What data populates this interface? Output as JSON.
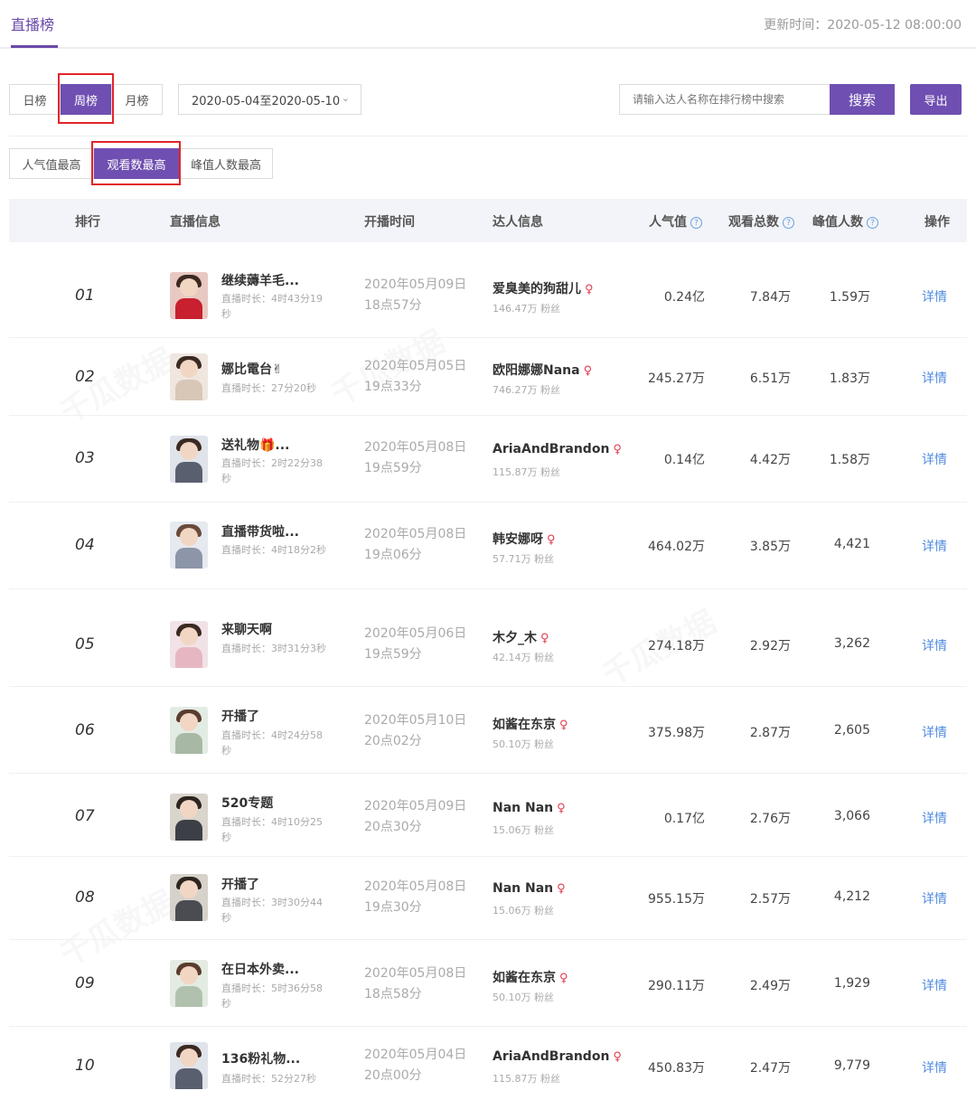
{
  "header": {
    "active_tab": "直播榜",
    "update_label": "更新时间：",
    "update_time": "2020-05-12 08:00:00"
  },
  "period": {
    "day": "日榜",
    "week": "周榜",
    "month": "月榜",
    "date_range": "2020-05-04至2020-05-10"
  },
  "search": {
    "placeholder": "请输入达人名称在排行榜中搜索",
    "button": "搜索"
  },
  "export_label": "导出",
  "sort": {
    "popularity": "人气值最高",
    "views": "观看数最高",
    "peak": "峰值人数最高"
  },
  "columns": {
    "rank": "排行",
    "live_info": "直播信息",
    "start_time": "开播时间",
    "kol_info": "达人信息",
    "popularity": "人气值",
    "views": "观看总数",
    "peak": "峰值人数",
    "action": "操作"
  },
  "help_glyph": "?",
  "watermark": "千瓜数据",
  "colors": {
    "accent": "#6f4fb1",
    "link": "#4f8be0",
    "highlight": "#e0252b"
  },
  "rows": [
    {
      "rank": "01",
      "title": "继续薅羊毛...",
      "duration": "直播时长：4时43分19秒",
      "start_date": "2020年05月09日",
      "start_time": "18点57分",
      "kol": "爱臭美的狗甜儿",
      "fans": "146.47万 粉丝",
      "popularity": "0.24亿",
      "views": "7.84万",
      "peak": "1.59万",
      "action": "详情"
    },
    {
      "rank": "02",
      "title": "娜比電台✌",
      "duration": "直播时长：27分20秒",
      "start_date": "2020年05月05日",
      "start_time": "19点33分",
      "kol": "欧阳娜娜Nana",
      "fans": "746.27万 粉丝",
      "popularity": "245.27万",
      "views": "6.51万",
      "peak": "1.83万",
      "action": "详情"
    },
    {
      "rank": "03",
      "title": "送礼物🎁...",
      "duration": "直播时长：2时22分38秒",
      "start_date": "2020年05月08日",
      "start_time": "19点59分",
      "kol": "AriaAndBrandon",
      "fans": "115.87万 粉丝",
      "popularity": "0.14亿",
      "views": "4.42万",
      "peak": "1.58万",
      "action": "详情"
    },
    {
      "rank": "04",
      "title": "直播带货啦...",
      "duration": "直播时长：4时18分2秒",
      "start_date": "2020年05月08日",
      "start_time": "19点06分",
      "kol": "韩安娜呀",
      "fans": "57.71万 粉丝",
      "popularity": "464.02万",
      "views": "3.85万",
      "peak": "4,421",
      "action": "详情"
    },
    {
      "rank": "05",
      "title": "来聊天啊",
      "duration": "直播时长：3时31分3秒",
      "start_date": "2020年05月06日",
      "start_time": "19点59分",
      "kol": "木夕_木",
      "fans": "42.14万 粉丝",
      "popularity": "274.18万",
      "views": "2.92万",
      "peak": "3,262",
      "action": "详情"
    },
    {
      "rank": "06",
      "title": "开播了",
      "duration": "直播时长：4时24分58秒",
      "start_date": "2020年05月10日",
      "start_time": "20点02分",
      "kol": "如酱在东京",
      "fans": "50.10万 粉丝",
      "popularity": "375.98万",
      "views": "2.87万",
      "peak": "2,605",
      "action": "详情"
    },
    {
      "rank": "07",
      "title": "520专题",
      "duration": "直播时长：4时10分25秒",
      "start_date": "2020年05月09日",
      "start_time": "20点30分",
      "kol": "Nan Nan",
      "fans": "15.06万 粉丝",
      "popularity": "0.17亿",
      "views": "2.76万",
      "peak": "3,066",
      "action": "详情"
    },
    {
      "rank": "08",
      "title": "开播了",
      "duration": "直播时长：3时30分44秒",
      "start_date": "2020年05月08日",
      "start_time": "19点30分",
      "kol": "Nan Nan",
      "fans": "15.06万 粉丝",
      "popularity": "955.15万",
      "views": "2.57万",
      "peak": "4,212",
      "action": "详情"
    },
    {
      "rank": "09",
      "title": "在日本外卖...",
      "duration": "直播时长：5时36分58秒",
      "start_date": "2020年05月08日",
      "start_time": "18点58分",
      "kol": "如酱在东京",
      "fans": "50.10万 粉丝",
      "popularity": "290.11万",
      "views": "2.49万",
      "peak": "1,929",
      "action": "详情"
    },
    {
      "rank": "10",
      "title": "136粉礼物...",
      "duration": "直播时长：52分27秒",
      "start_date": "2020年05月04日",
      "start_time": "20点00分",
      "kol": "AriaAndBrandon",
      "fans": "115.87万 粉丝",
      "popularity": "450.83万",
      "views": "2.47万",
      "peak": "9,779",
      "action": "详情"
    }
  ]
}
